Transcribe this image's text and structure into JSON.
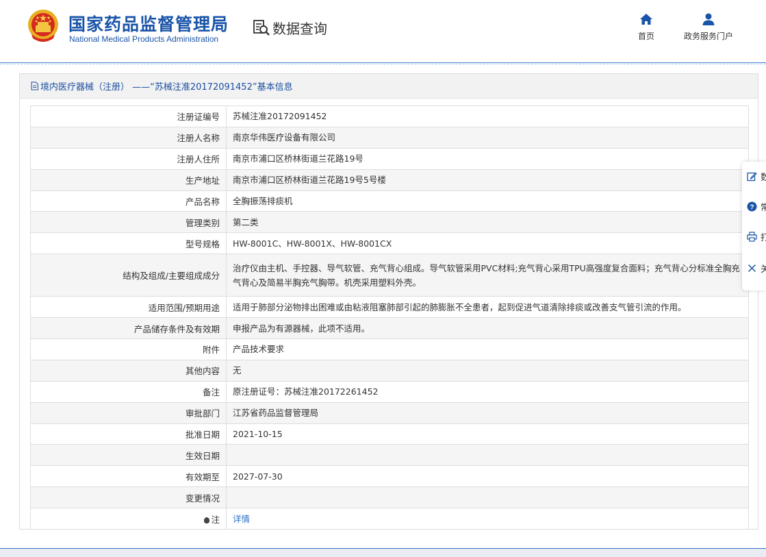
{
  "header": {
    "brand_cn": "国家药品监督管理局",
    "brand_en": "National Medical Products Administration",
    "data_query": "数据查询",
    "nav": {
      "home": "首页",
      "portal": "政务服务门户"
    }
  },
  "panel": {
    "title": "境内医疗器械（注册） ——“苏械注准20172091452”基本信息"
  },
  "rows": [
    {
      "label": "注册证编号",
      "value": "苏械注准20172091452"
    },
    {
      "label": "注册人名称",
      "value": "南京华伟医疗设备有限公司"
    },
    {
      "label": "注册人住所",
      "value": "南京市浦口区桥林街道兰花路19号"
    },
    {
      "label": "生产地址",
      "value": "南京市浦口区桥林街道兰花路19号5号楼"
    },
    {
      "label": "产品名称",
      "value": "全胸振荡排痰机"
    },
    {
      "label": "管理类别",
      "value": "第二类"
    },
    {
      "label": "型号规格",
      "value": "HW-8001C、HW-8001X、HW-8001CX"
    },
    {
      "label": "结构及组成/主要组成成分",
      "value": "治疗仪由主机、手控器、导气软管、充气背心组成。导气软管采用PVC材料;充气背心采用TPU高强度复合面料；充气背心分标准全胸充气背心及简易半胸充气胸带。机壳采用塑料外壳。"
    },
    {
      "label": "适用范围/预期用途",
      "value": "适用于肺部分泌物排出困难或由粘液阻塞肺部引起的肺膨胀不全患者，起到促进气道清除排痰或改善支气管引流的作用。"
    },
    {
      "label": "产品储存条件及有效期",
      "value": "申报产品为有源器械，此项不适用。"
    },
    {
      "label": "附件",
      "value": "产品技术要求"
    },
    {
      "label": "其他内容",
      "value": "无"
    },
    {
      "label": "备注",
      "value": "原注册证号：苏械注准20172261452"
    },
    {
      "label": "审批部门",
      "value": "江苏省药品监督管理局"
    },
    {
      "label": "批准日期",
      "value": "2021-10-15"
    },
    {
      "label": "生效日期",
      "value": ""
    },
    {
      "label": "有效期至",
      "value": "2027-07-30"
    },
    {
      "label": "变更情况",
      "value": ""
    },
    {
      "label": "注",
      "value": "详情"
    }
  ],
  "sidebar": {
    "items": [
      {
        "label": "数",
        "icon": "edit-icon"
      },
      {
        "label": "常",
        "icon": "question-icon"
      },
      {
        "label": "打",
        "icon": "print-icon"
      },
      {
        "label": "关",
        "icon": "close-icon"
      }
    ]
  },
  "colors": {
    "brand": "#1a54a8",
    "link": "#2a6fc6",
    "accent_line": "#3d7fcf"
  }
}
